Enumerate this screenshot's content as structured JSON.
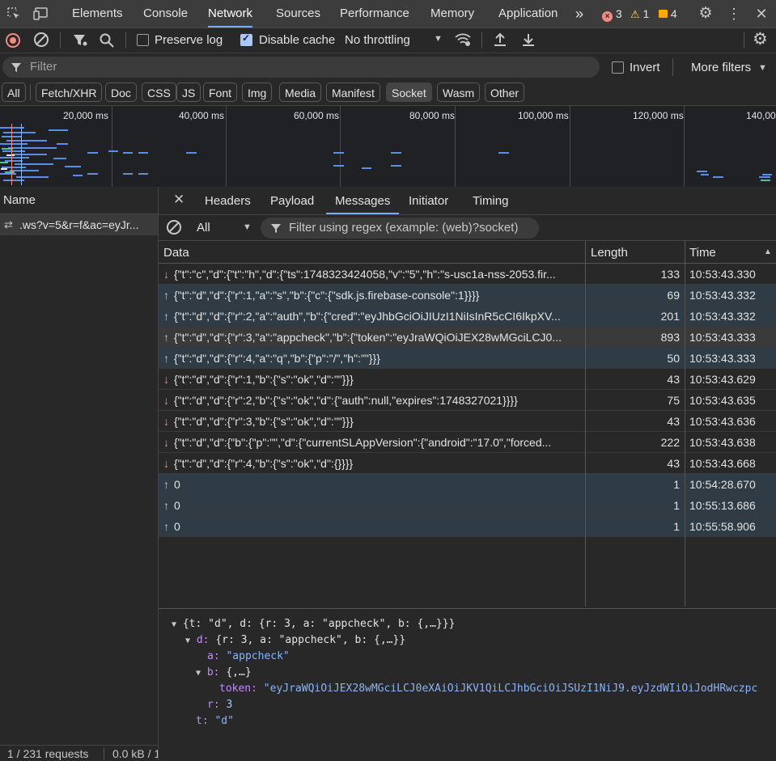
{
  "topbar": {
    "tabs": [
      "Elements",
      "Console",
      "Network",
      "Sources",
      "Performance",
      "Memory",
      "Application"
    ],
    "active_tab": "Network",
    "more_tabs": "»",
    "errors": "3",
    "warnings": "1",
    "issues": "4"
  },
  "toolbar": {
    "preserve_log": "Preserve log",
    "disable_cache": "Disable cache",
    "throttling": "No throttling"
  },
  "filter": {
    "placeholder": "Filter",
    "invert": "Invert",
    "more_filters": "More filters"
  },
  "type_chips": [
    "All",
    "Fetch/XHR",
    "Doc",
    "CSS",
    "JS",
    "Font",
    "Img",
    "Media",
    "Manifest",
    "Socket",
    "Wasm",
    "Other"
  ],
  "active_chip": "Socket",
  "overview": {
    "ticks": [
      "20,000 ms",
      "40,000 ms",
      "60,000 ms",
      "80,000 ms",
      "100,000 ms",
      "120,000 ms",
      "140,00"
    ]
  },
  "requests": {
    "header": "Name",
    "items": [
      ".ws?v=5&r=f&ac=eyJr..."
    ],
    "status": "1 / 231 requests",
    "transferred": "0.0 kB / 1"
  },
  "detail_tabs": [
    "Headers",
    "Payload",
    "Messages",
    "Initiator",
    "Timing"
  ],
  "active_detail_tab": "Messages",
  "messages_filter": {
    "type": "All",
    "placeholder": "Filter using regex (example: (web)?socket)"
  },
  "columns": {
    "data": "Data",
    "length": "Length",
    "time": "Time"
  },
  "messages": [
    {
      "dir": "down",
      "data": "{\"t\":\"c\",\"d\":{\"t\":\"h\",\"d\":{\"ts\":1748323424058,\"v\":\"5\",\"h\":\"s-usc1a-nss-2053.fir...",
      "length": "133",
      "time": "10:53:43.330"
    },
    {
      "dir": "up",
      "data": "{\"t\":\"d\",\"d\":{\"r\":1,\"a\":\"s\",\"b\":{\"c\":{\"sdk.js.firebase-console\":1}}}}",
      "length": "69",
      "time": "10:53:43.332"
    },
    {
      "dir": "up",
      "data": "{\"t\":\"d\",\"d\":{\"r\":2,\"a\":\"auth\",\"b\":{\"cred\":\"eyJhbGciOiJIUzI1NiIsInR5cCI6IkpXV...",
      "length": "201",
      "time": "10:53:43.332"
    },
    {
      "dir": "up",
      "data": "{\"t\":\"d\",\"d\":{\"r\":3,\"a\":\"appcheck\",\"b\":{\"token\":\"eyJraWQiOiJEX28wMGciLCJ0...",
      "length": "893",
      "time": "10:53:43.333"
    },
    {
      "dir": "up",
      "data": "{\"t\":\"d\",\"d\":{\"r\":4,\"a\":\"q\",\"b\":{\"p\":\"/\",\"h\":\"\"}}}",
      "length": "50",
      "time": "10:53:43.333"
    },
    {
      "dir": "down",
      "data": "{\"t\":\"d\",\"d\":{\"r\":1,\"b\":{\"s\":\"ok\",\"d\":\"\"}}}",
      "length": "43",
      "time": "10:53:43.629"
    },
    {
      "dir": "down",
      "data": "{\"t\":\"d\",\"d\":{\"r\":2,\"b\":{\"s\":\"ok\",\"d\":{\"auth\":null,\"expires\":1748327021}}}}",
      "length": "75",
      "time": "10:53:43.635"
    },
    {
      "dir": "down",
      "data": "{\"t\":\"d\",\"d\":{\"r\":3,\"b\":{\"s\":\"ok\",\"d\":\"\"}}}",
      "length": "43",
      "time": "10:53:43.636"
    },
    {
      "dir": "down",
      "data": "{\"t\":\"d\",\"d\":{\"b\":{\"p\":\"\",\"d\":{\"currentSLAppVersion\":{\"android\":\"17.0\",\"forced...",
      "length": "222",
      "time": "10:53:43.638"
    },
    {
      "dir": "down",
      "data": "{\"t\":\"d\",\"d\":{\"r\":4,\"b\":{\"s\":\"ok\",\"d\":{}}}}",
      "length": "43",
      "time": "10:53:43.668"
    },
    {
      "dir": "up",
      "data": "0",
      "length": "1",
      "time": "10:54:28.670"
    },
    {
      "dir": "up",
      "data": "0",
      "length": "1",
      "time": "10:55:13.686"
    },
    {
      "dir": "up",
      "data": "0",
      "length": "1",
      "time": "10:55:58.906"
    }
  ],
  "selected_index": 3,
  "tree": {
    "root": "{t: \"d\", d: {r: 3, a: \"appcheck\", b: {,…}}}",
    "d_key": "d:",
    "d_val": " {r: 3, a: \"appcheck\", b: {,…}}",
    "a_key": "a:",
    "a_val": " \"appcheck\"",
    "b_key": "b:",
    "b_val": " {,…}",
    "token_key": "token:",
    "token_val": " \"eyJraWQiOiJEX28wMGciLCJ0eXAiOiJKV1QiLCJhbGciOiJSUzI1NiJ9.eyJzdWIiOiJodHRwczpc",
    "r_key": "r:",
    "r_val": " 3",
    "t_key": "t:",
    "t_val": " \"d\""
  }
}
